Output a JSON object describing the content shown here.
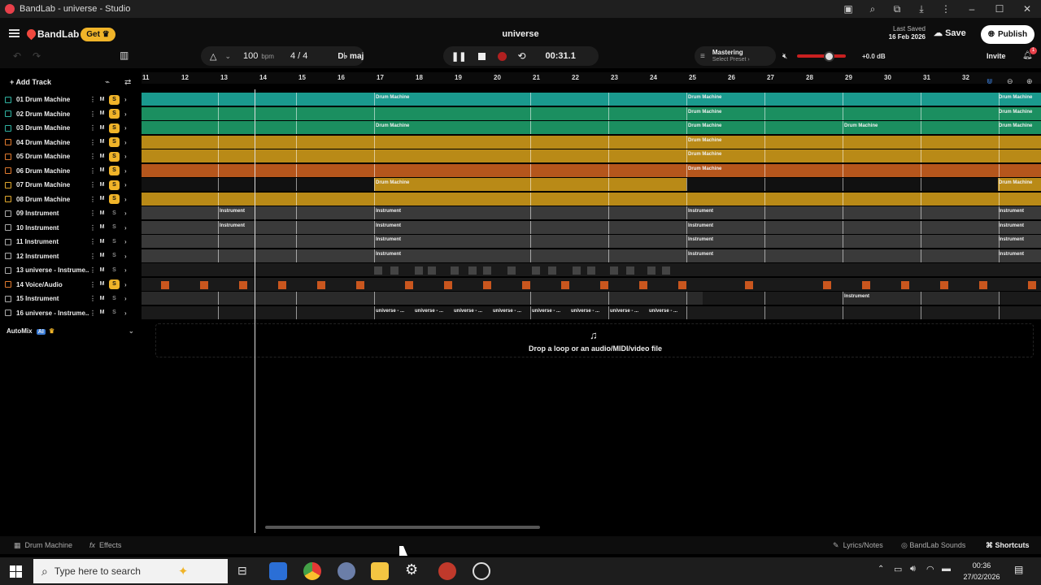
{
  "window": {
    "title": "BandLab - universe - Studio",
    "controls": [
      "–",
      "☐",
      "✕"
    ]
  },
  "header": {
    "brand": "BandLab",
    "get_label": "Get",
    "project_title": "universe",
    "last_saved_label": "Last Saved",
    "last_saved_date": "16 Feb 2026",
    "save_label": "Save",
    "publish_label": "Publish"
  },
  "toolbar": {
    "bpm_value": "100",
    "bpm_unit": "bpm",
    "time_sig": "4 / 4",
    "key": "D♭ maj",
    "time": "00:31.1",
    "mastering_title": "Mastering",
    "mastering_sub": "Select Preset ›",
    "volume_db": "+0.0 dB",
    "invite_label": "Invite",
    "notif_count": "1"
  },
  "add_track_label": "Add Track",
  "ruler": [
    "11",
    "12",
    "13",
    "14",
    "15",
    "16",
    "17",
    "18",
    "19",
    "20",
    "21",
    "22",
    "23",
    "24",
    "25",
    "26",
    "27",
    "28",
    "29",
    "30",
    "31",
    "32"
  ],
  "tracks": [
    {
      "num": "01",
      "name": "Drum Machine",
      "solo": true
    },
    {
      "num": "02",
      "name": "Drum Machine",
      "solo": true
    },
    {
      "num": "03",
      "name": "Drum Machine",
      "solo": true
    },
    {
      "num": "04",
      "name": "Drum Machine",
      "solo": true
    },
    {
      "num": "05",
      "name": "Drum Machine",
      "solo": true
    },
    {
      "num": "06",
      "name": "Drum Machine",
      "solo": true
    },
    {
      "num": "07",
      "name": "Drum Machine",
      "solo": true
    },
    {
      "num": "08",
      "name": "Drum Machine",
      "solo": true
    },
    {
      "num": "09",
      "name": "Instrument",
      "solo": false
    },
    {
      "num": "10",
      "name": "Instrument",
      "solo": false
    },
    {
      "num": "11",
      "name": "Instrument",
      "solo": false
    },
    {
      "num": "12",
      "name": "Instrument",
      "solo": false
    },
    {
      "num": "13",
      "name": "universe - Instrume...",
      "solo": false
    },
    {
      "num": "14",
      "name": "Voice/Audio",
      "solo": true
    },
    {
      "num": "15",
      "name": "Instrument",
      "solo": false
    },
    {
      "num": "16",
      "name": "universe - Instrume...",
      "solo": false
    }
  ],
  "track_buttons": {
    "mute": "M",
    "solo": "S",
    "more": "⋮",
    "expand": "›"
  },
  "region_labels": {
    "drum": "Drum Machine",
    "instrument": "Instrument",
    "universe": "universe - ..."
  },
  "automix_label": "AutoMix",
  "ai_badge": "AI",
  "drop_text": "Drop a loop or an audio/MIDI/video file",
  "bottom": {
    "drum_machine": "Drum Machine",
    "effects": "Effects",
    "lyrics": "Lyrics/Notes",
    "sounds": "BandLab Sounds",
    "shortcuts": "Shortcuts"
  },
  "taskbar": {
    "search_placeholder": "Type here to search",
    "clock_time": "00:36",
    "clock_date": "27/02/2026"
  },
  "colors": {
    "teal": "#1a9a8e",
    "green": "#1b8f60",
    "gold": "#b98a17",
    "orange": "#b5561c",
    "gray": "#3a3a3a",
    "accent": "#f0b429"
  }
}
